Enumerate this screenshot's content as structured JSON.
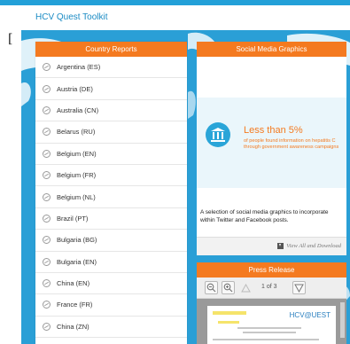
{
  "header": {
    "title": "HCV Quest Toolkit"
  },
  "country_reports": {
    "title": "Country Reports",
    "items": [
      "Argentina (ES)",
      "Austria (DE)",
      "Australia (CN)",
      "Belarus (RU)",
      "Belgium (EN)",
      "Belgium (FR)",
      "Belgium (NL)",
      "Brazil (PT)",
      "Bulgaria (BG)",
      "Bulgaria (EN)",
      "China (EN)",
      "France (FR)",
      "China (ZN)"
    ]
  },
  "social_media": {
    "title": "Social Media Graphics",
    "stat_big": "Less than 5%",
    "stat_small": "of people found information on hepatitis C through government awareness campaigns",
    "description": "A selection of social media graphics to incorporate within Twitter and Facebook posts.",
    "view_all": "View All and Download"
  },
  "press_release": {
    "title": "Press Release",
    "page_indicator": "1 of 3",
    "doc_logo": "HCV@UEST"
  },
  "icons": {
    "country": "globe-icon",
    "zoom_out": "zoom-out-icon",
    "zoom_in": "zoom-in-icon",
    "prev": "prev-page-icon",
    "next": "next-page-icon"
  },
  "colors": {
    "accent": "#f47a20",
    "brand_blue": "#23a0d8"
  }
}
